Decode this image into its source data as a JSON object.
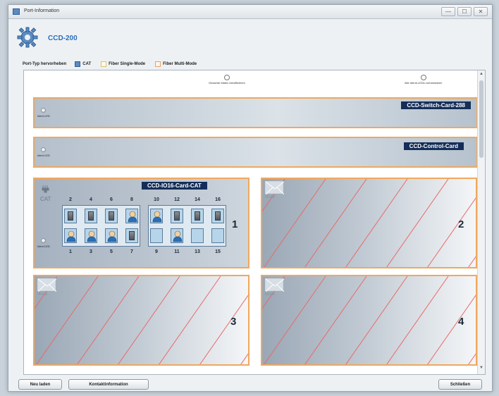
{
  "window": {
    "title": "Port-Information",
    "buttons": [
      "—",
      "☐",
      "✕"
    ]
  },
  "app": {
    "title": "CCD-200",
    "icon": "gear-icon"
  },
  "filter": {
    "label": "Port-Typ hervorheben",
    "options": [
      {
        "label": "CAT",
        "checked": true
      },
      {
        "label": "Fiber Single-Mode",
        "checked": false
      },
      {
        "label": "Fiber Multi-Mode",
        "checked": false
      }
    ]
  },
  "controls": {
    "identify_label": "Gesamte Matrix identifizieren",
    "all_leds_label": "Alle Identi-LEDs zurücksetzen"
  },
  "cards": {
    "switch": {
      "label": "CCD-Switch-Card-288",
      "led_label": "Ident LED"
    },
    "control": {
      "label": "CCD-Control-Card",
      "led_label": "Ident LED"
    },
    "io": {
      "label": "CCD-IO16-Card-CAT",
      "type_label": "CAT",
      "led_label": "Ident LED",
      "slot": "1",
      "top_ports": [
        "2",
        "4",
        "6",
        "8",
        "10",
        "12",
        "14",
        "16"
      ],
      "bottom_ports": [
        "1",
        "3",
        "5",
        "7",
        "9",
        "11",
        "13",
        "15"
      ]
    }
  },
  "slots": [
    {
      "num": "2",
      "label": "None"
    },
    {
      "num": "3",
      "label": "None"
    },
    {
      "num": "4",
      "label": "None"
    }
  ],
  "buttons": {
    "reload": "Neu laden",
    "contact": "Kontaktinformation",
    "close": "Schließen"
  },
  "colors": {
    "card_border": "#f0a85c",
    "label_bg": "#142e59",
    "accent": "#2c6db8",
    "stripe": "#e86a6a"
  }
}
